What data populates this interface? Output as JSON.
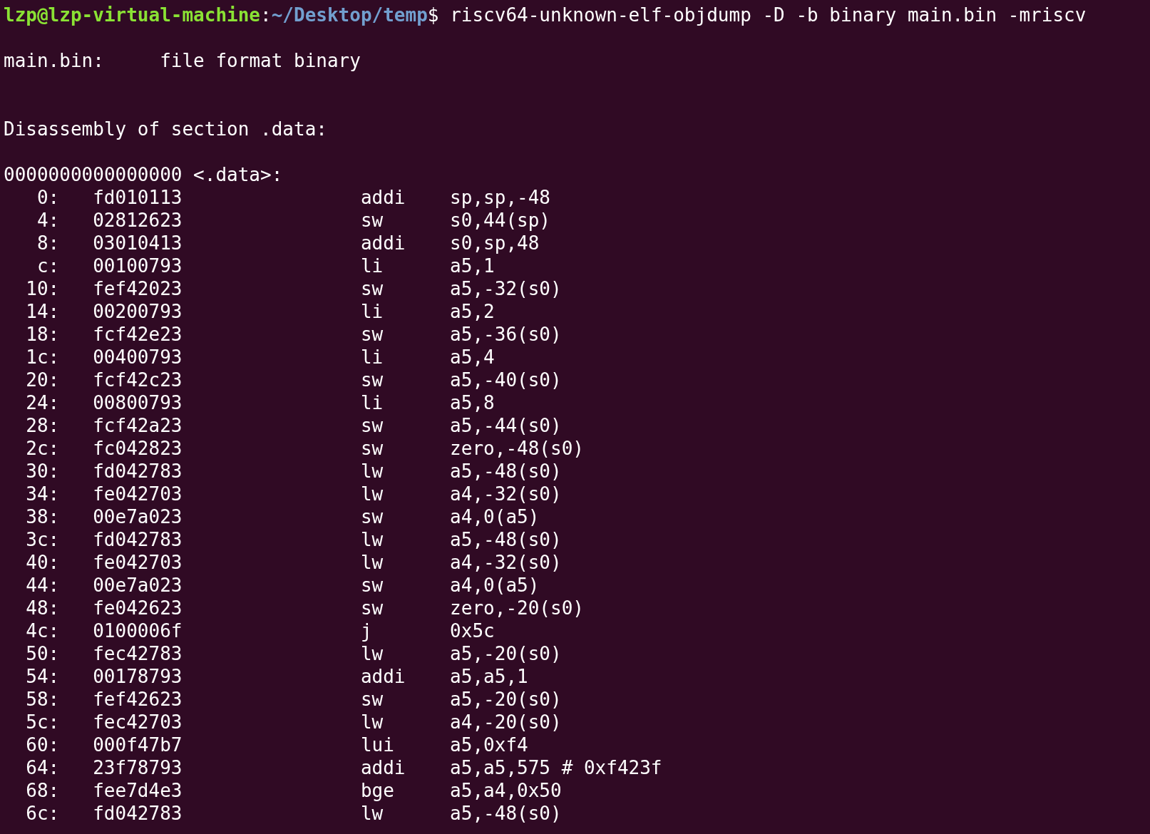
{
  "prompt": {
    "user_host": "lzp@lzp-virtual-machine",
    "separator": ":",
    "path": "~/Desktop/temp",
    "symbol": "$",
    "command": "riscv64-unknown-elf-objdump -D -b binary main.bin -mriscv"
  },
  "file_line": {
    "name": "main.bin:",
    "format": "file format binary"
  },
  "section_heading": "Disassembly of section .data:",
  "symbol_line": "0000000000000000 <.data>:",
  "rows": [
    {
      "address": "0:",
      "bytes": "fd010113",
      "mnemonic": "addi",
      "operands": "sp,sp,-48"
    },
    {
      "address": "4:",
      "bytes": "02812623",
      "mnemonic": "sw",
      "operands": "s0,44(sp)"
    },
    {
      "address": "8:",
      "bytes": "03010413",
      "mnemonic": "addi",
      "operands": "s0,sp,48"
    },
    {
      "address": "c:",
      "bytes": "00100793",
      "mnemonic": "li",
      "operands": "a5,1"
    },
    {
      "address": "10:",
      "bytes": "fef42023",
      "mnemonic": "sw",
      "operands": "a5,-32(s0)"
    },
    {
      "address": "14:",
      "bytes": "00200793",
      "mnemonic": "li",
      "operands": "a5,2"
    },
    {
      "address": "18:",
      "bytes": "fcf42e23",
      "mnemonic": "sw",
      "operands": "a5,-36(s0)"
    },
    {
      "address": "1c:",
      "bytes": "00400793",
      "mnemonic": "li",
      "operands": "a5,4"
    },
    {
      "address": "20:",
      "bytes": "fcf42c23",
      "mnemonic": "sw",
      "operands": "a5,-40(s0)"
    },
    {
      "address": "24:",
      "bytes": "00800793",
      "mnemonic": "li",
      "operands": "a5,8"
    },
    {
      "address": "28:",
      "bytes": "fcf42a23",
      "mnemonic": "sw",
      "operands": "a5,-44(s0)"
    },
    {
      "address": "2c:",
      "bytes": "fc042823",
      "mnemonic": "sw",
      "operands": "zero,-48(s0)"
    },
    {
      "address": "30:",
      "bytes": "fd042783",
      "mnemonic": "lw",
      "operands": "a5,-48(s0)"
    },
    {
      "address": "34:",
      "bytes": "fe042703",
      "mnemonic": "lw",
      "operands": "a4,-32(s0)"
    },
    {
      "address": "38:",
      "bytes": "00e7a023",
      "mnemonic": "sw",
      "operands": "a4,0(a5)"
    },
    {
      "address": "3c:",
      "bytes": "fd042783",
      "mnemonic": "lw",
      "operands": "a5,-48(s0)"
    },
    {
      "address": "40:",
      "bytes": "fe042703",
      "mnemonic": "lw",
      "operands": "a4,-32(s0)"
    },
    {
      "address": "44:",
      "bytes": "00e7a023",
      "mnemonic": "sw",
      "operands": "a4,0(a5)"
    },
    {
      "address": "48:",
      "bytes": "fe042623",
      "mnemonic": "sw",
      "operands": "zero,-20(s0)"
    },
    {
      "address": "4c:",
      "bytes": "0100006f",
      "mnemonic": "j",
      "operands": "0x5c"
    },
    {
      "address": "50:",
      "bytes": "fec42783",
      "mnemonic": "lw",
      "operands": "a5,-20(s0)"
    },
    {
      "address": "54:",
      "bytes": "00178793",
      "mnemonic": "addi",
      "operands": "a5,a5,1"
    },
    {
      "address": "58:",
      "bytes": "fef42623",
      "mnemonic": "sw",
      "operands": "a5,-20(s0)"
    },
    {
      "address": "5c:",
      "bytes": "fec42703",
      "mnemonic": "lw",
      "operands": "a4,-20(s0)"
    },
    {
      "address": "60:",
      "bytes": "000f47b7",
      "mnemonic": "lui",
      "operands": "a5,0xf4"
    },
    {
      "address": "64:",
      "bytes": "23f78793",
      "mnemonic": "addi",
      "operands": "a5,a5,575 # 0xf423f"
    },
    {
      "address": "68:",
      "bytes": "fee7d4e3",
      "mnemonic": "bge",
      "operands": "a5,a4,0x50"
    },
    {
      "address": "6c:",
      "bytes": "fd042783",
      "mnemonic": "lw",
      "operands": "a5,-48(s0)"
    }
  ]
}
